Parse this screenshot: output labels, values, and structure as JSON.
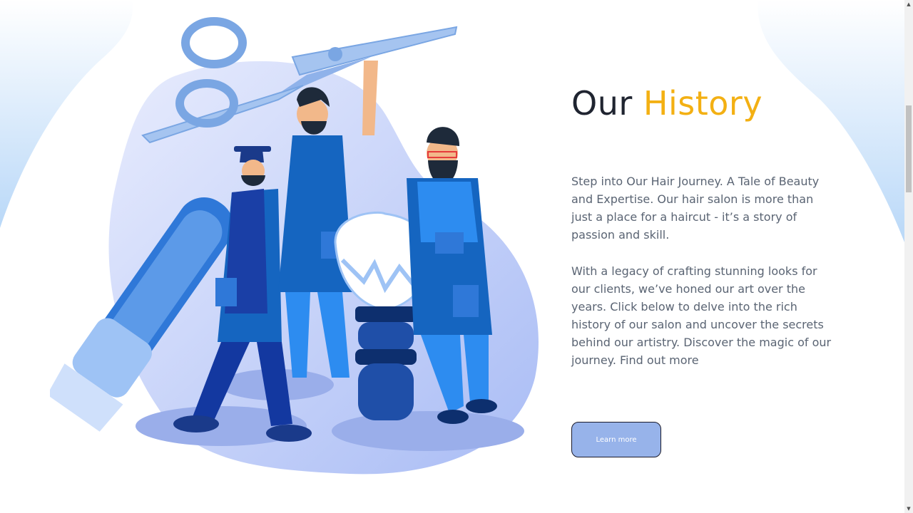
{
  "section": {
    "title_part1": "Our ",
    "title_part2": "History",
    "paragraph1": "Step into Our Hair Journey. A Tale of Beauty and Expertise. Our hair salon is more than just a place for a haircut - it’s a story of passion and skill.",
    "paragraph2": "With a legacy of crafting stunning looks for our clients, we’ve honed our art over the years. Click below to delve into the rich history of our salon and uncover the secrets behind our artistry. Discover the magic of our journey. Find out more",
    "button_label": "Learn more"
  },
  "illustration": {
    "subject": "three barbers with giant scissors, clipper and shaving brush",
    "icons": [
      "scissors-icon",
      "hair-clipper-icon",
      "shaving-brush-icon"
    ]
  },
  "colors": {
    "title": "#1f2430",
    "accent": "#f3b013",
    "body_text": "#5a6473",
    "button_bg": "#97b3ea",
    "button_border": "#1a1a2a",
    "illustration_primary": "#1565c0",
    "illustration_light": "#c9d3fb"
  },
  "scrollbar": {
    "up_arrow": "▲",
    "down_arrow": "▼"
  }
}
